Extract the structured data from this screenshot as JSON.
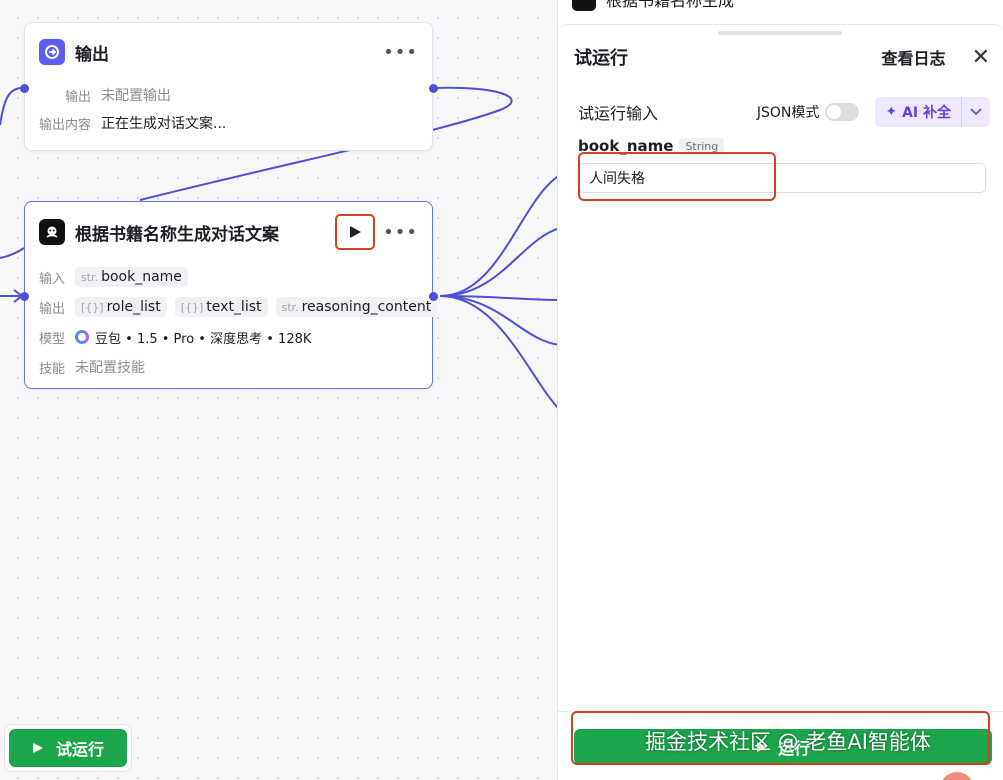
{
  "canvas": {
    "output_node": {
      "title": "输出",
      "row1_label": "输出",
      "row1_value": "未配置输出",
      "row2_label": "输出内容",
      "row2_value": "正在生成对话文案..."
    },
    "llm_node": {
      "title": "根据书籍名称生成对话文案",
      "input_label": "输入",
      "input_tag_type": "str.",
      "input_tag": "book_name",
      "output_label": "输出",
      "outputs": [
        {
          "type": "[{}]",
          "name": "role_list"
        },
        {
          "type": "[{}]",
          "name": "text_list"
        },
        {
          "type": "str.",
          "name": "reasoning_content"
        }
      ],
      "model_label": "模型",
      "model_value": "豆包 • 1.5 • Pro • 深度思考 • 128K",
      "skill_label": "技能",
      "skill_value": "未配置技能"
    },
    "trial_button": "试运行"
  },
  "panel": {
    "top_title": "根据书籍名称生成",
    "title": "试运行",
    "view_log": "查看日志",
    "input_title": "试运行输入",
    "json_mode": "JSON模式",
    "ai_complete": "AI 补全",
    "param_name": "book_name",
    "param_type": "String",
    "param_value": "人间失格",
    "run_button": "运行"
  },
  "watermark": "掘金技术社区 @ 老鱼AI智能体",
  "colors": {
    "accent": "#4e4fd6",
    "run_green": "#1ca64c",
    "highlight_red": "#d2401f",
    "ai_purple": "#6a3fe0"
  }
}
